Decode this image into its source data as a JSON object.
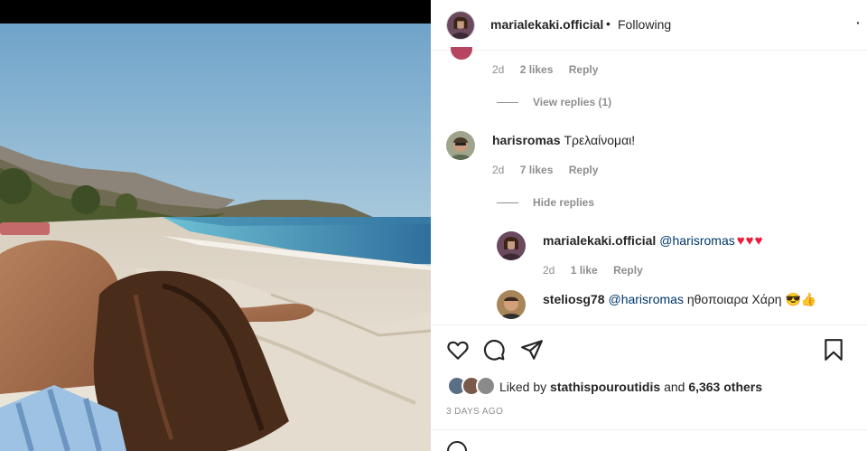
{
  "header": {
    "username": "marialekaki.official",
    "separator": "•",
    "follow_status": "Following",
    "more": "·"
  },
  "comments": [
    {
      "meta": {
        "time": "2d",
        "likes": "2 likes",
        "reply": "Reply"
      },
      "replies_toggle": "View replies (1)"
    },
    {
      "username": "harisromas",
      "text": "Τρελαίνομαι!",
      "meta": {
        "time": "2d",
        "likes": "7 likes",
        "reply": "Reply"
      },
      "replies_toggle": "Hide replies",
      "replies": [
        {
          "username": "marialekaki.official",
          "mention": "@harisromas",
          "emoji": "♥♥♥",
          "meta": {
            "time": "2d",
            "likes": "1 like",
            "reply": "Reply"
          }
        },
        {
          "username": "steliosg78",
          "mention": "@harisromas",
          "text": "ηθοποιαρα Χάρη",
          "emoji": "😎👍"
        }
      ]
    }
  ],
  "actions": {
    "like_icon": "heart-icon",
    "comment_icon": "comment-icon",
    "share_icon": "send-icon",
    "save_icon": "bookmark-icon"
  },
  "likes": {
    "prefix": "Liked by",
    "user": "stathispouroutidis",
    "connector": "and",
    "others": "6,363 others"
  },
  "timestamp": "3 DAYS AGO",
  "colors": {
    "text": "#262626",
    "secondary": "#8e8e8e",
    "mention": "#00376b",
    "heart": "#ed1c3a"
  }
}
